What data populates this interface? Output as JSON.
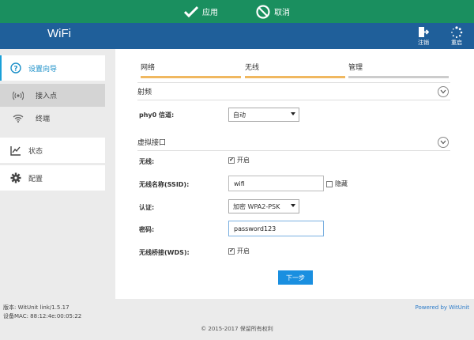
{
  "actionbar": {
    "apply_label": "应用",
    "cancel_label": "取消"
  },
  "header": {
    "brand": "WiFi",
    "logout_label": "注销",
    "restart_label": "重启"
  },
  "sidebar": {
    "wizard": "设置向导",
    "sub_items": [
      "接入点",
      "终端"
    ],
    "status": "状态",
    "config": "配置"
  },
  "steps": [
    "网络",
    "无线",
    "管理"
  ],
  "sections": {
    "radio": "射频",
    "vif": "虚拟接口"
  },
  "form": {
    "channel_label": "phy0 信道:",
    "channel_value": "自动",
    "wireless_label": "无线:",
    "wireless_check": "开启",
    "ssid_label": "无线名称(SSID):",
    "ssid_value": "wifi",
    "hidden_label": "隐藏",
    "auth_label": "认证:",
    "auth_value": "加密 WPA2-PSK",
    "password_label": "密码:",
    "password_value": "password123",
    "wds_label": "无线桥接(WDS):",
    "wds_check": "开启",
    "next_label": "下一步"
  },
  "footer": {
    "version": "版本: WitUnit link/1.5.17",
    "mac": "设备MAC: 88:12:4e:00:05:22",
    "powered": "Powered by WitUnit",
    "copyright": "© 2015-2017  保留所有权利"
  },
  "colors": {
    "actionbar": "#1a8f5f",
    "header": "#1f5f9a",
    "accent": "#1a8fe0",
    "step_active": "#f0b860"
  }
}
